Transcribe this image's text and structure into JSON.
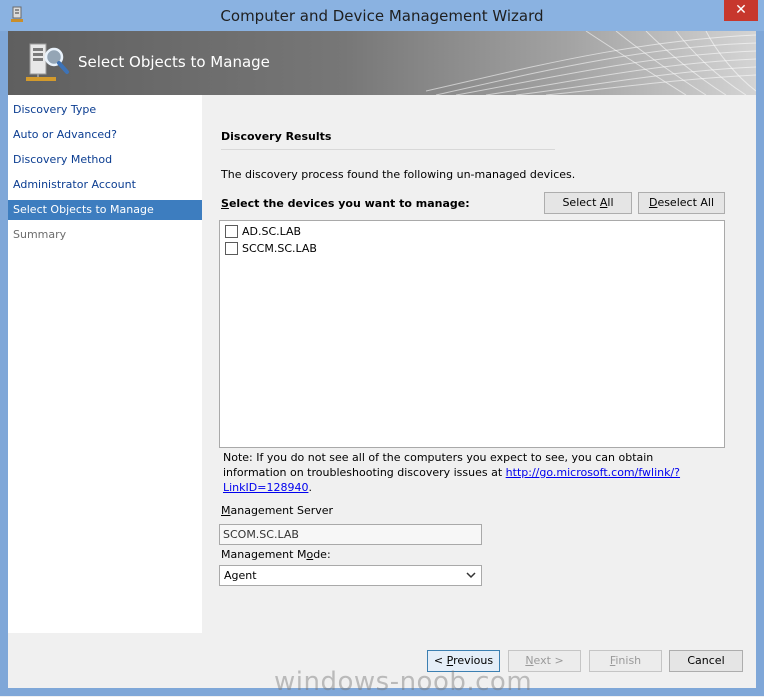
{
  "window": {
    "title": "Computer and Device Management Wizard",
    "close_label": "✕"
  },
  "header": {
    "title": "Select Objects to Manage"
  },
  "nav": {
    "items": [
      {
        "label": "Discovery Type"
      },
      {
        "label": "Auto or Advanced?"
      },
      {
        "label": "Discovery Method"
      },
      {
        "label": "Administrator Account"
      },
      {
        "label": "Select Objects to Manage"
      },
      {
        "label": "Summary"
      }
    ]
  },
  "content": {
    "section_title": "Discovery Results",
    "description": "The discovery process found the following un-managed devices.",
    "select_label_first": "S",
    "select_label_rest": "elect the devices you want to manage:",
    "select_all_pre": "Select ",
    "select_all_acc": "A",
    "select_all_post": "ll",
    "deselect_all_pre": "",
    "deselect_all_acc": "D",
    "deselect_all_post": "eselect All",
    "devices": [
      {
        "name": "AD.SC.LAB",
        "checked": false
      },
      {
        "name": "SCCM.SC.LAB",
        "checked": false
      }
    ],
    "note_text": "Note: If you do not see all of the computers you expect to see, you can obtain information on troubleshooting discovery issues at ",
    "note_link": "http://go.microsoft.com/fwlink/?LinkID=128940",
    "note_end": ".",
    "mgmt_server_label_acc": "M",
    "mgmt_server_label_rest": "anagement Server",
    "mgmt_server_value": "SCOM.SC.LAB",
    "mgmt_mode_label_pre": "Management M",
    "mgmt_mode_label_acc": "o",
    "mgmt_mode_label_post": "de:",
    "mgmt_mode_value": "Agent"
  },
  "buttons": {
    "previous_pre": "< ",
    "previous_acc": "P",
    "previous_post": "revious",
    "next_acc": "N",
    "next_post": "ext >",
    "finish_acc": "F",
    "finish_post": "inish",
    "cancel": "Cancel"
  },
  "watermark": "windows-noob.com"
}
